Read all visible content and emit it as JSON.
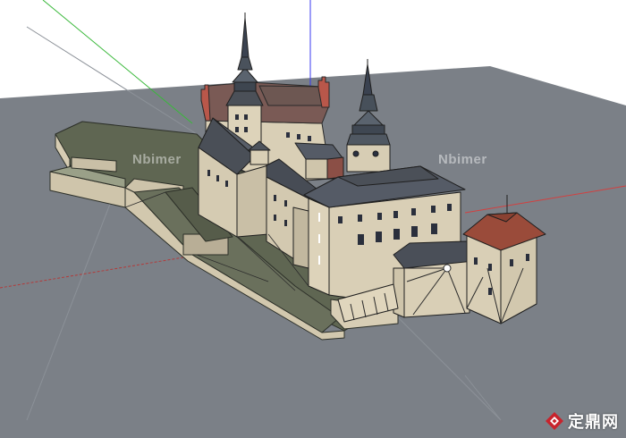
{
  "watermarks": {
    "left": "Nbimer",
    "right": "Nbimer"
  },
  "brand": {
    "text": "定鼎网",
    "mark_icon": "diamond-logo-icon",
    "mark_color": "#c8232c"
  },
  "colors": {
    "sky": "#ffffff",
    "ground": "#7b8087",
    "terrain": "#5f6652",
    "wall": "#d9cfb6",
    "roof_slate": "#4d5159",
    "roof_red": "#9a4b3a",
    "axis_blue": "#3a3af0",
    "axis_green": "#39b83a",
    "axis_red": "#d24040"
  }
}
